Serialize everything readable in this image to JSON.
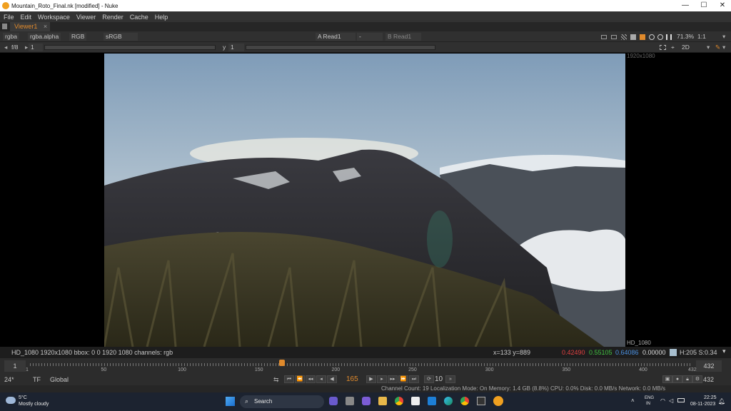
{
  "window": {
    "title": "Mountain_Roto_Final.nk [modified] - Nuke"
  },
  "menu": [
    "File",
    "Edit",
    "Workspace",
    "Viewer",
    "Render",
    "Cache",
    "Help"
  ],
  "tab": {
    "label": "Viewer1",
    "close": "×"
  },
  "viewer_toolbar": {
    "channels": "rgba",
    "alpha": "rgba.alpha",
    "display": "RGB",
    "colorspace": "sRGB",
    "input_a": "A  Read1",
    "op": "-",
    "input_b": "B  Read1",
    "zoom": "71.3%",
    "ratio": "1:1",
    "fstop": "f/8",
    "frame_step": "1",
    "gamma_label": "y",
    "gamma_value": "1",
    "view_mode": "2D"
  },
  "viewer": {
    "format_label": "HD_1080",
    "format_top": "1920x1080"
  },
  "status": {
    "info": "HD_1080 1920x1080  bbox: 0 0 1920 1080 channels: rgb",
    "coords": "x=133 y=889",
    "r": "0.42490",
    "g": "0.55105",
    "b": "0.64086",
    "a": "0.00000",
    "hs": "H:205 S:0.34"
  },
  "timeline": {
    "start": "1",
    "end": "432",
    "current": "165",
    "tick_labels": [
      "1",
      "50",
      "100",
      "150",
      "200",
      "250",
      "300",
      "350",
      "400",
      "432"
    ],
    "current_fraction": 0.38
  },
  "playback": {
    "fps": "24*",
    "mode": "TF",
    "scope": "Global",
    "frame": "165",
    "increment": "10",
    "end": "432"
  },
  "footer": {
    "text": "Channel Count: 19  Localization Mode: On  Memory: 1.4 GB (8.8%)  CPU: 0.0%  Disk: 0.0 MB/s  Network: 0.0 MB/s"
  },
  "taskbar": {
    "weather_temp": "5°C",
    "weather_desc": "Mostly cloudy",
    "search": "Search",
    "lang1": "ENG",
    "lang2": "IN",
    "time": "22:25",
    "date": "08-11-2023"
  },
  "colors": {
    "accent": "#e08a2c",
    "red": "#e04040",
    "green": "#40c040",
    "blue": "#4a90e0"
  }
}
